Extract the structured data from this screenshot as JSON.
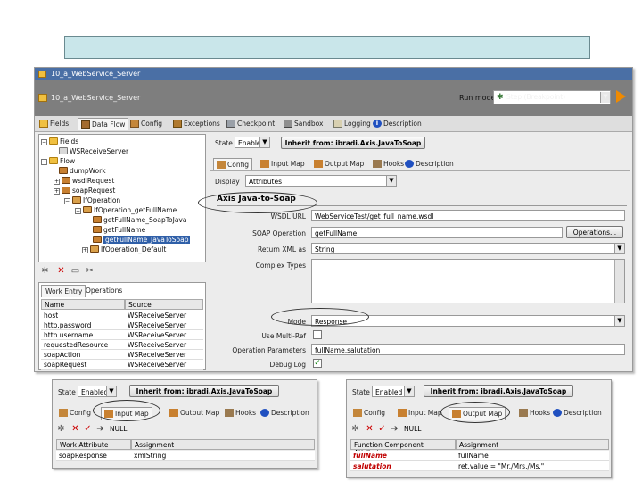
{
  "window": {
    "title": "10_a_WebService_Server",
    "project_name": "10_a_WebService_Server",
    "runmode_label": "Run mode",
    "runmode_value": "Step (Breakpoint)"
  },
  "main_tabs": [
    "Fields",
    "Data Flow",
    "Config",
    "Exceptions",
    "Checkpoint",
    "Sandbox",
    "Logging",
    "Description"
  ],
  "tree": {
    "items": [
      {
        "label": "Fields"
      },
      {
        "label": "WSReceiveServer"
      },
      {
        "label": "Flow"
      },
      {
        "label": "dumpWork"
      },
      {
        "label": "wsdlRequest"
      },
      {
        "label": "soapRequest"
      },
      {
        "label": "IfOperation"
      },
      {
        "label": "IfOperation_getFullName"
      },
      {
        "label": "getFullName_SoapToJava"
      },
      {
        "label": "getFullName"
      },
      {
        "label": "getFullName_JavaToSoap"
      },
      {
        "label": "IfOperation_Default"
      }
    ]
  },
  "bottom_tabs": [
    "Work Entry",
    "Operations"
  ],
  "work_table": {
    "headers": [
      "Name",
      "Source"
    ],
    "rows": [
      {
        "name": "host",
        "source": "WSReceiveServer"
      },
      {
        "name": "http.password",
        "source": "WSReceiveServer"
      },
      {
        "name": "http.username",
        "source": "WSReceiveServer"
      },
      {
        "name": "requestedResource",
        "source": "WSReceiveServer"
      },
      {
        "name": "soapAction",
        "source": "WSReceiveServer"
      },
      {
        "name": "soapRequest",
        "source": "WSReceiveServer"
      }
    ]
  },
  "right": {
    "state_label": "State",
    "state_value": "Enabled",
    "inherit_button": "Inherit from: ibradi.Axis.JavaToSoap",
    "tabs": [
      "Config",
      "Input Map",
      "Output Map",
      "Hooks",
      "Description"
    ],
    "display_label": "Display",
    "display_value": "Attributes",
    "section_title": "Axis Java-to-Soap",
    "fields": [
      {
        "label": "WSDL URL",
        "value": "WebServiceTest/get_full_name.wsdl"
      },
      {
        "label": "SOAP Operation",
        "value": "getFullName"
      },
      {
        "label": "Return XML as",
        "value": "String"
      },
      {
        "label": "Complex Types",
        "value": ""
      },
      {
        "label": "Mode",
        "value": "Response"
      },
      {
        "label": "Use Multi-Ref",
        "value": ""
      },
      {
        "label": "Operation Parameters",
        "value": "fullName,salutation"
      },
      {
        "label": "Debug Log",
        "value": ""
      }
    ],
    "operations_button": "Operations..."
  },
  "input_map_panel": {
    "state_label": "State",
    "state_value": "Enabled",
    "inherit_button": "Inherit from: ibradi.Axis.JavaToSoap",
    "tabs": [
      "Config",
      "Input Map",
      "Output Map",
      "Hooks",
      "Description"
    ],
    "null_label": "NULL",
    "headers": [
      "Work Attribute",
      "Assignment"
    ],
    "row": {
      "attr": "soapResponse",
      "value": "xmlString"
    }
  },
  "output_map_panel": {
    "state_label": "State",
    "state_value": "Enabled",
    "inherit_button": "Inherit from: ibradi.Axis.JavaToSoap",
    "tabs": [
      "Config",
      "Input Map",
      "Output Map",
      "Hooks",
      "Description"
    ],
    "null_label": "NULL",
    "headers": [
      "Function Component Attribute",
      "Assignment"
    ],
    "rows": [
      {
        "attr": "fullName",
        "value": "fullName"
      },
      {
        "attr": "salutation",
        "value": "ret.value = \"Mr./Mrs./Ms.\""
      }
    ]
  },
  "colors": {
    "banner": "#c9e6ea",
    "title_bar": "#4a6fa5",
    "dark_bar": "#7e7e7e",
    "selection": "#2f5fa8",
    "required_attr": "#c00000"
  }
}
